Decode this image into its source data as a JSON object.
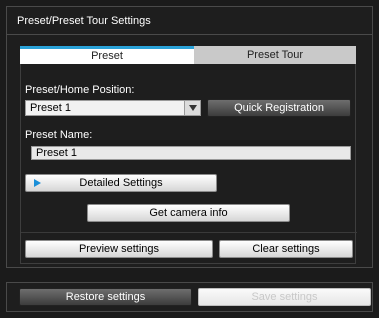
{
  "panel": {
    "title": "Preset/Preset Tour Settings"
  },
  "tabs": [
    {
      "label": "Preset",
      "active": true
    },
    {
      "label": "Preset Tour",
      "active": false
    }
  ],
  "preset": {
    "position_label": "Preset/Home Position:",
    "position_value": "Preset 1",
    "quick_registration_label": "Quick Registration",
    "name_label": "Preset Name:",
    "name_value": "Preset 1",
    "detailed_settings_label": "Detailed Settings",
    "get_camera_info_label": "Get camera info",
    "preview_settings_label": "Preview settings",
    "clear_settings_label": "Clear settings"
  },
  "footer": {
    "restore_label": "Restore settings",
    "save_label": "Save settings",
    "save_enabled": false
  },
  "colors": {
    "background": "#1b1b1b",
    "active_tab_accent": "#2aa2d8",
    "detail_arrow": "#1a8fd8"
  },
  "icons": {
    "dropdown": "chevron-down-icon",
    "detail": "play-triangle-icon"
  }
}
